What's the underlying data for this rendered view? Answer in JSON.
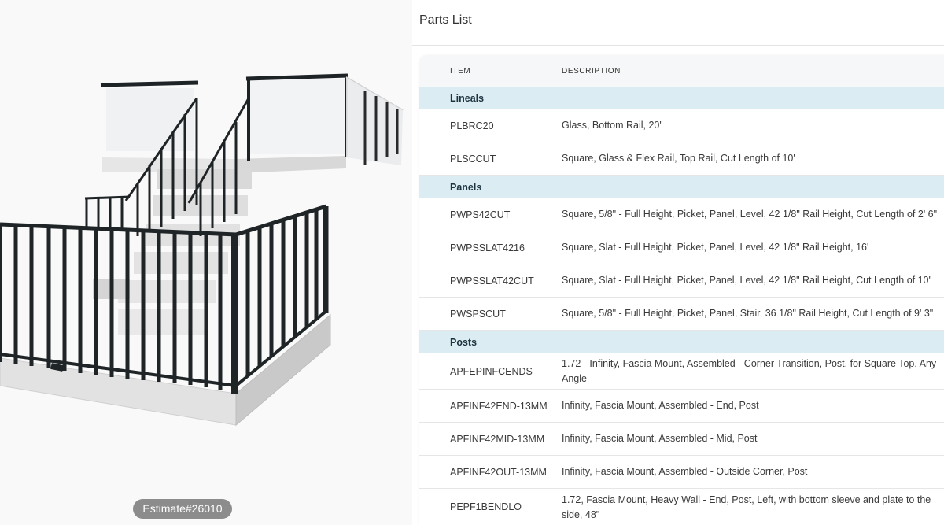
{
  "viewer": {
    "estimate_label": "Estimate#26010",
    "scene": "3d-railing-model"
  },
  "panel": {
    "title": "Parts List",
    "columns": {
      "item": "ITEM",
      "description": "DESCRIPTION"
    },
    "groups": [
      {
        "name": "Lineals",
        "rows": [
          {
            "item": "PLBRC20",
            "description": "Glass, Bottom Rail, 20'"
          },
          {
            "item": "PLSCCUT",
            "description": "Square, Glass & Flex Rail, Top Rail, Cut Length of 10'"
          }
        ]
      },
      {
        "name": "Panels",
        "rows": [
          {
            "item": "PWPS42CUT",
            "description": "Square, 5/8\" - Full Height, Picket, Panel, Level, 42 1/8\" Rail Height, Cut Length of 2' 6\""
          },
          {
            "item": "PWPSSLAT4216",
            "description": "Square, Slat - Full Height, Picket, Panel, Level, 42 1/8\" Rail Height, 16'"
          },
          {
            "item": "PWPSSLAT42CUT",
            "description": "Square, Slat - Full Height, Picket, Panel, Level, 42 1/8\" Rail Height, Cut Length of 10'"
          },
          {
            "item": "PWSPSCUT",
            "description": "Square, 5/8\" - Full Height, Picket, Panel, Stair, 36 1/8\" Rail Height, Cut Length of 9' 3\""
          }
        ]
      },
      {
        "name": "Posts",
        "rows": [
          {
            "item": "APFEPINFCENDS",
            "description": "1.72 - Infinity, Fascia Mount, Assembled - Corner Transition, Post, for Square Top, Any Angle"
          },
          {
            "item": "APFINF42END-13MM",
            "description": "Infinity, Fascia Mount, Assembled - End, Post"
          },
          {
            "item": "APFINF42MID-13MM",
            "description": "Infinity, Fascia Mount, Assembled - Mid, Post"
          },
          {
            "item": "APFINF42OUT-13MM",
            "description": "Infinity, Fascia Mount, Assembled - Outside Corner, Post"
          },
          {
            "item": "PEPF1BENDLO",
            "description": "1.72, Fascia Mount, Heavy Wall - End, Post, Left, with bottom sleeve and plate to the side, 48\""
          }
        ]
      }
    ]
  }
}
